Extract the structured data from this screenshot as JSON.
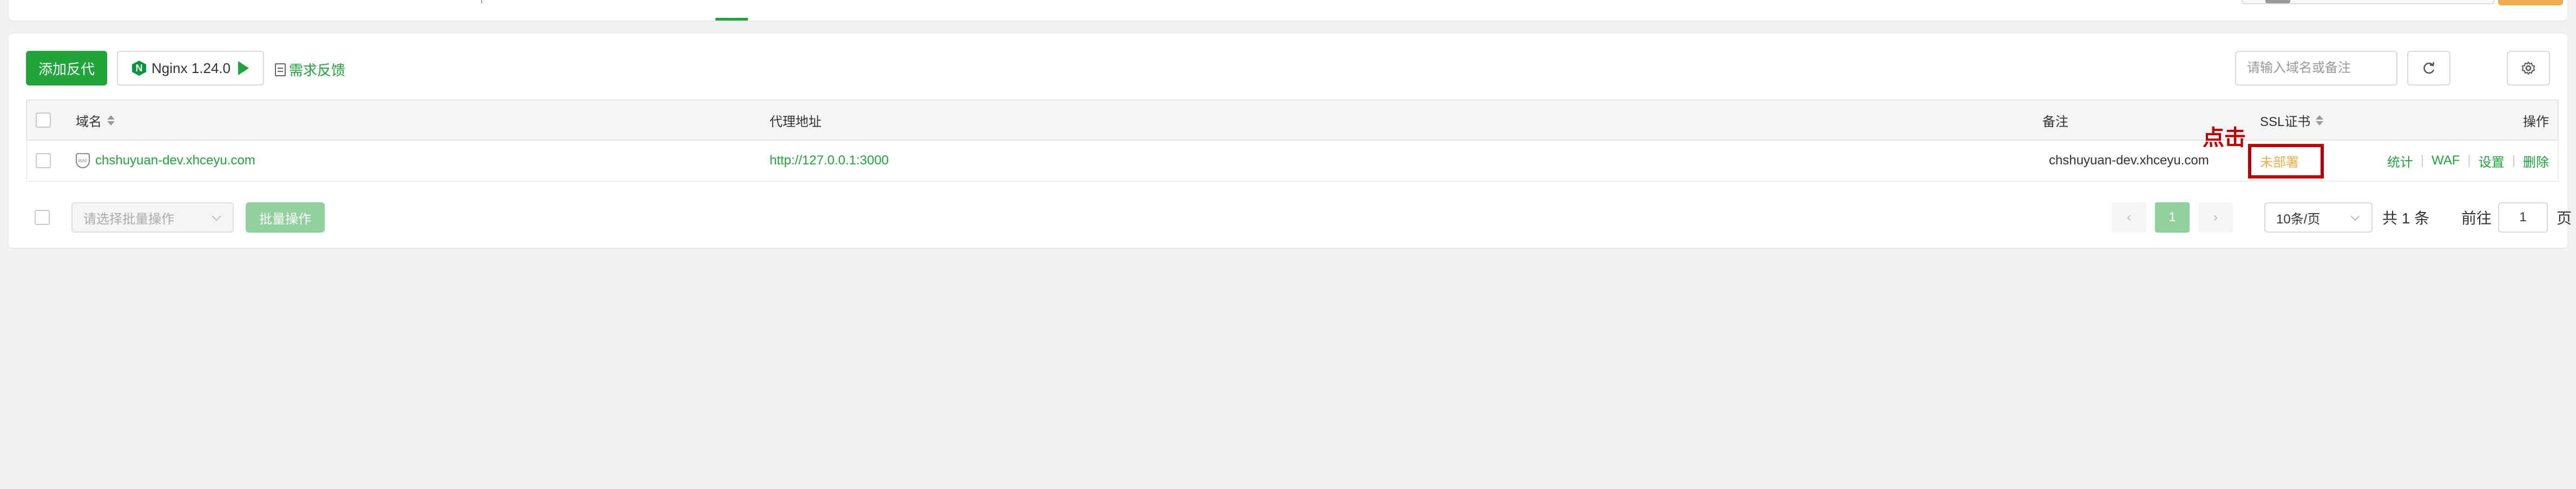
{
  "toolbar": {
    "add_proxy_label": "添加反代",
    "nginx_version": "Nginx 1.24.0",
    "nginx_logo": "N",
    "feedback_label": "需求反馈"
  },
  "search": {
    "placeholder": "请输入域名或备注"
  },
  "table": {
    "headers": {
      "domain": "域名",
      "proxy_address": "代理地址",
      "remark": "备注",
      "ssl": "SSL证书",
      "actions": "操作"
    },
    "rows": [
      {
        "shield_text": "WAF",
        "domain": "chshuyuan-dev.xhceyu.com",
        "proxy_address": "http://127.0.0.1:3000",
        "remark": "chshuyuan-dev.xhceyu.com",
        "ssl_status": "未部署",
        "actions": [
          "统计",
          "WAF",
          "设置",
          "删除"
        ]
      }
    ]
  },
  "annotation": "点击",
  "footer": {
    "batch_select_placeholder": "请选择批量操作",
    "batch_button": "批量操作",
    "prev": "‹",
    "current_page": "1",
    "next": "›",
    "page_size": "10条/页",
    "total_text": "共 1 条",
    "goto_label": "前往",
    "goto_value": "1",
    "page_suffix": "页"
  },
  "colors": {
    "primary": "#20a53a",
    "warning": "#f0ad4e",
    "annotation": "#c00000"
  }
}
